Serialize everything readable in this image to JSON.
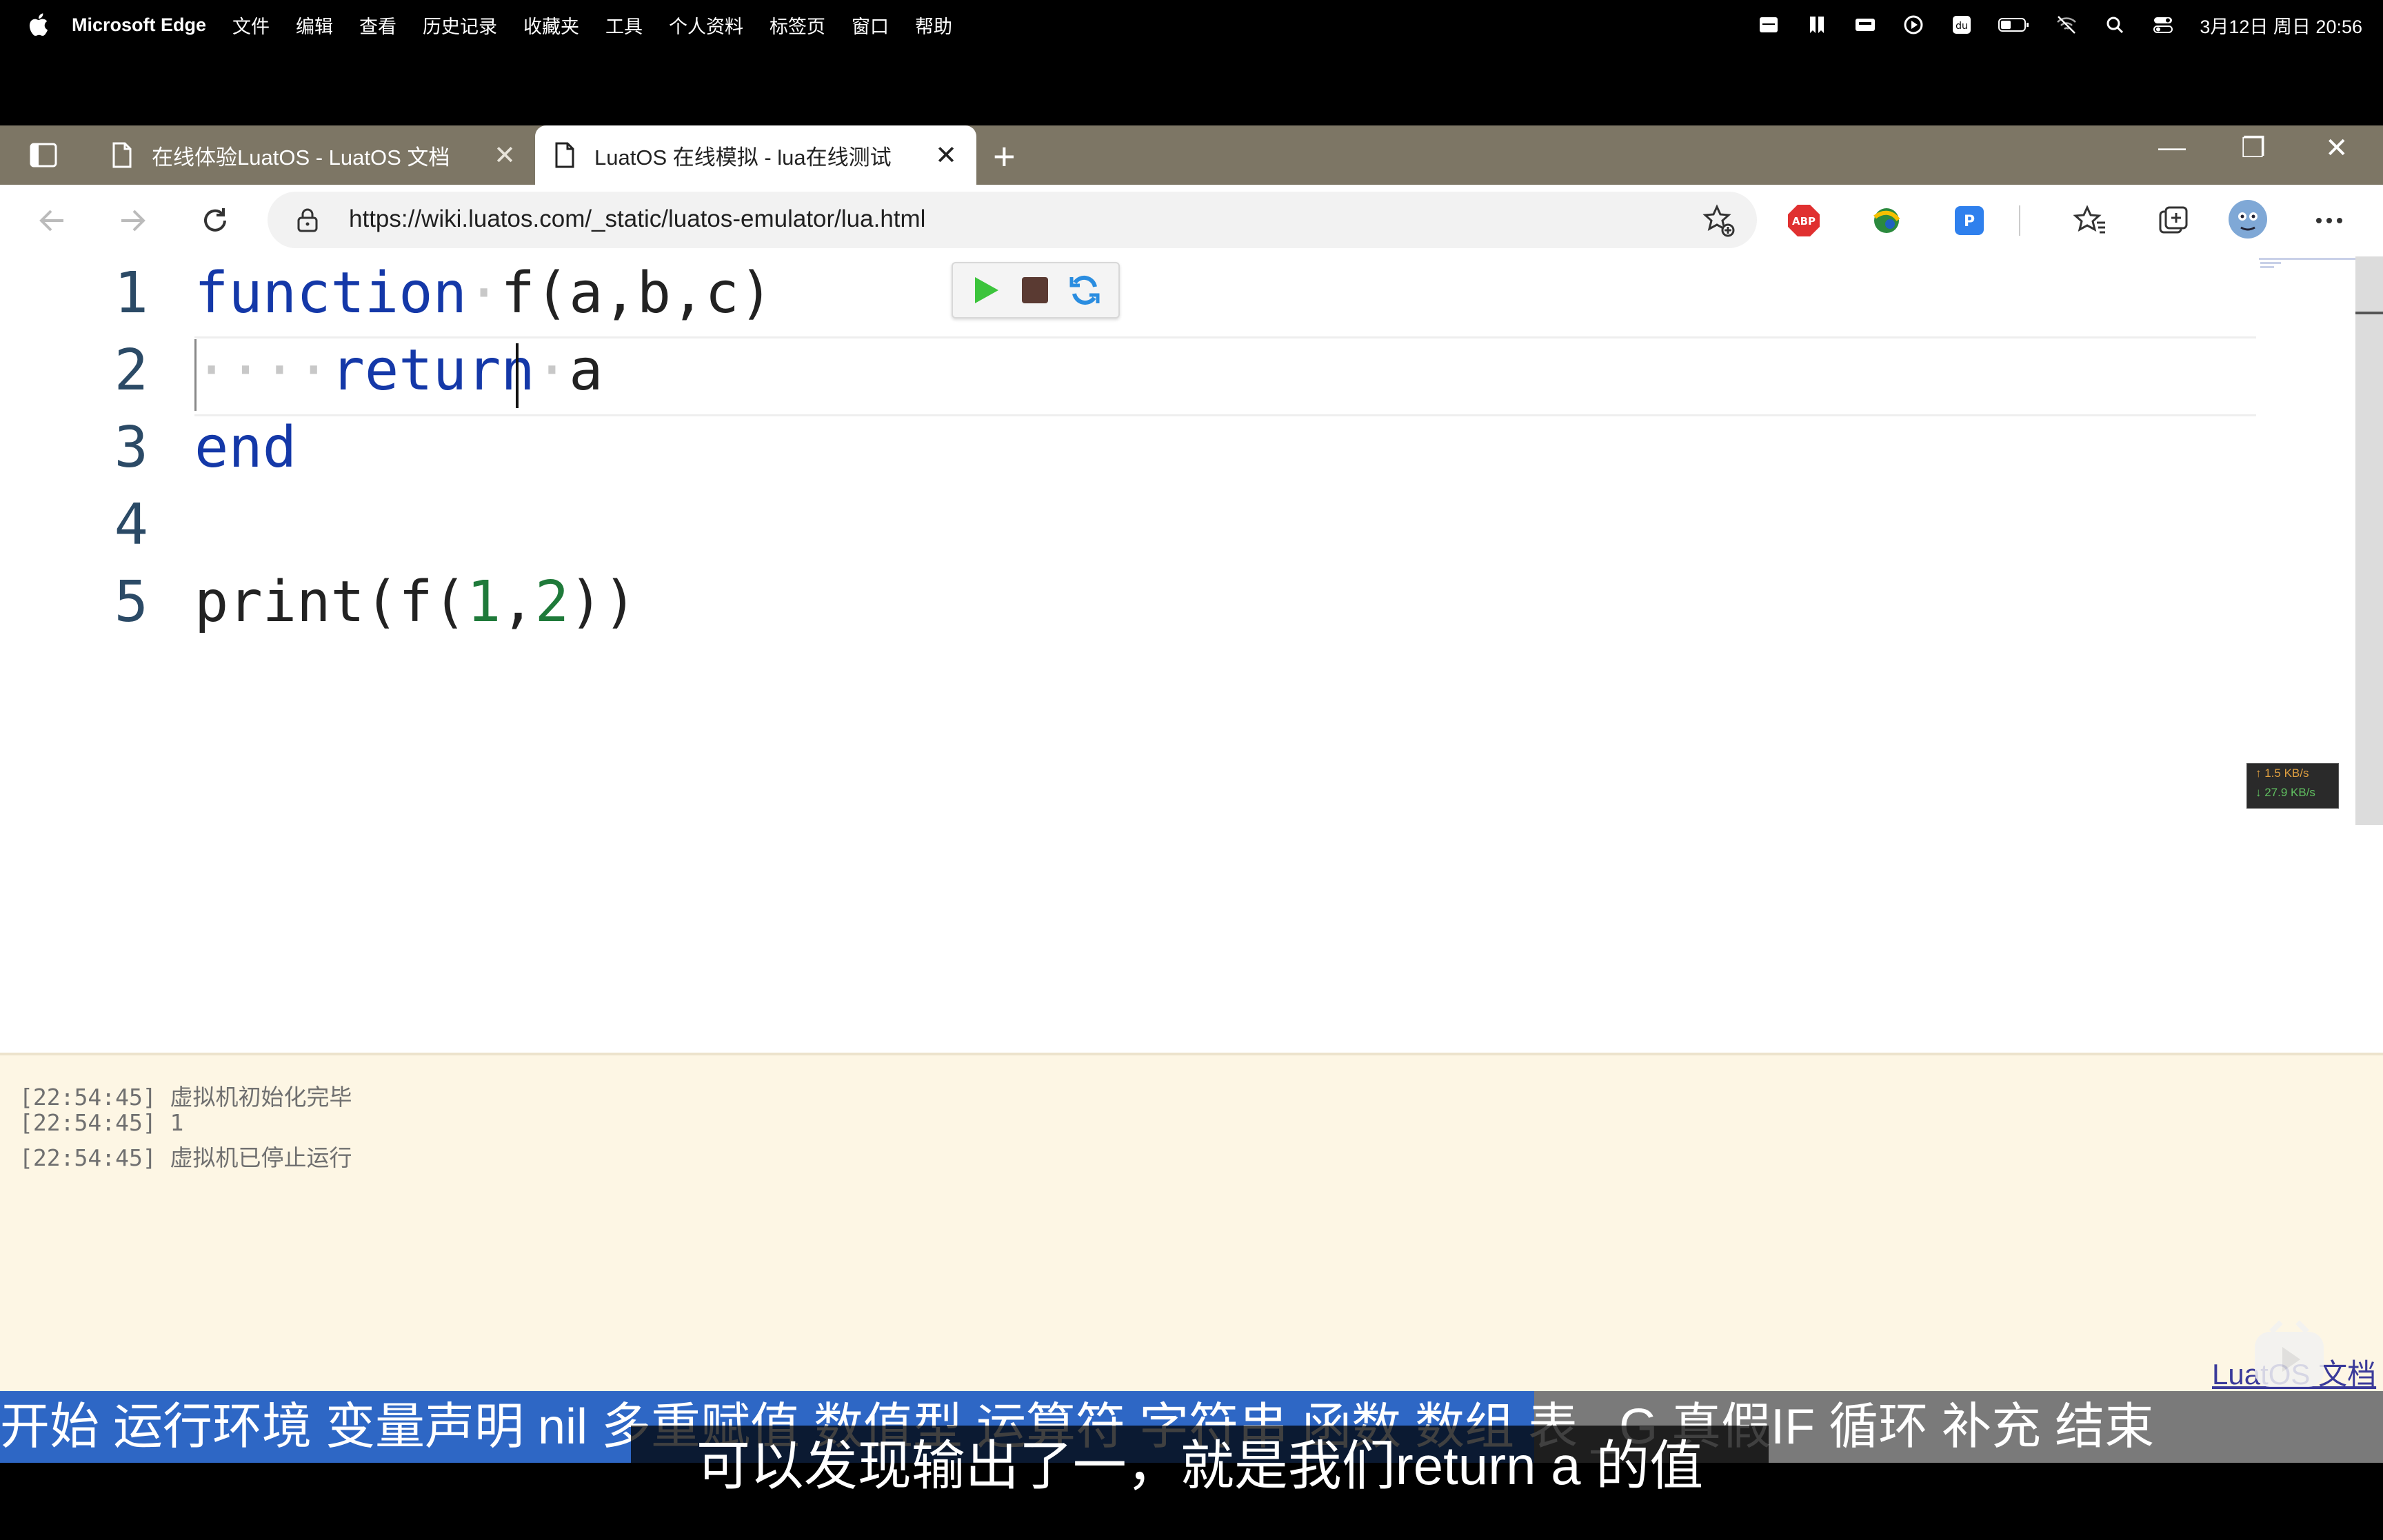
{
  "menubar": {
    "app_name": "Microsoft Edge",
    "items": [
      "文件",
      "编辑",
      "查看",
      "历史记录",
      "收藏夹",
      "工具",
      "个人资料",
      "标签页",
      "窗口",
      "帮助"
    ],
    "clock": "3月12日 周日 20:56"
  },
  "tabs": [
    {
      "title": "在线体验LuatOS - LuatOS 文档",
      "active": false
    },
    {
      "title": "LuatOS 在线模拟 - lua在线测试",
      "active": true
    }
  ],
  "address_bar": {
    "url": "https://wiki.luatos.com/_static/luatos-emulator/lua.html"
  },
  "extensions": [
    "adblock-plus-icon",
    "globe-extension-icon",
    "translate-extension-icon"
  ],
  "editor": {
    "line_numbers": [
      "1",
      "2",
      "3",
      "4",
      "5"
    ],
    "lines": [
      [
        {
          "t": "function",
          "c": "kw"
        },
        {
          "t": "·",
          "c": "ws"
        },
        {
          "t": "f(a,b,c)",
          "c": "plain"
        }
      ],
      [
        {
          "t": "····",
          "c": "ws"
        },
        {
          "t": "return",
          "c": "kw"
        },
        {
          "t": "·",
          "c": "ws"
        },
        {
          "t": "a",
          "c": "plain"
        }
      ],
      [
        {
          "t": "end",
          "c": "kw"
        }
      ],
      [],
      [
        {
          "t": "print(f(",
          "c": "plain"
        },
        {
          "t": "1",
          "c": "num"
        },
        {
          "t": ",",
          "c": "plain"
        },
        {
          "t": "2",
          "c": "num"
        },
        {
          "t": "))",
          "c": "plain"
        }
      ]
    ]
  },
  "network_monitor": {
    "up": "↑ 1.5 KB/s",
    "down": "↓ 27.9 KB/s"
  },
  "console": {
    "lines": [
      "[22:54:45] 虚拟机初始化完毕",
      "[22:54:45] 1",
      "[22:54:45] 虚拟机已停止运行"
    ]
  },
  "doc_link": "LuatOS 文档",
  "video": {
    "chapters": "开始 运行环境 变量声明 nil 多重赋值 数值型 运算符 字符串 函数 数组 表 _G 真假IF 循环 补充 结束",
    "subtitle": "可以发现输出了一，就是我们return a 的值"
  }
}
